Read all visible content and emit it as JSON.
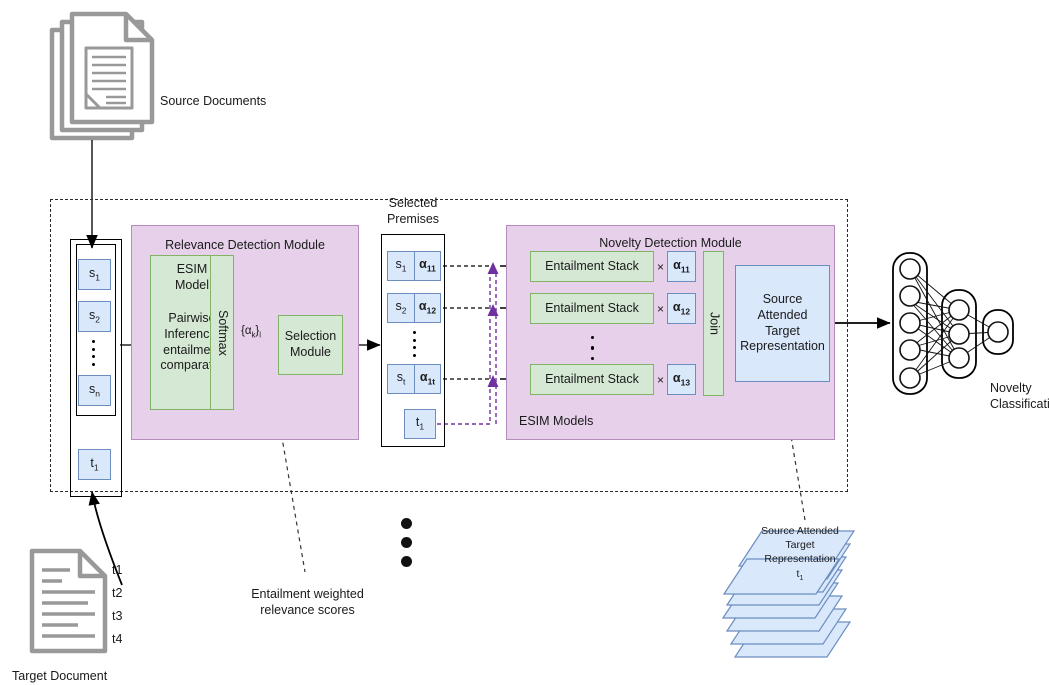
{
  "figure": {
    "source_documents_label": "Source Documents",
    "target_document_label": "Target Document",
    "target_sentences": [
      "t1",
      "t2",
      "t3",
      "t4"
    ],
    "novelty_classification_label": "Novelty Classification",
    "entailment_caption_line1": "Entailment weighted",
    "entailment_caption_line2": "relevance scores"
  },
  "input_stack": {
    "source_items": [
      "s1",
      "s2",
      "sn"
    ],
    "target_item": "t1"
  },
  "relevance_module": {
    "title": "Relevance Detection Module",
    "esim_title_line1": "ESIM",
    "esim_title_line2": "Model",
    "esim_body_line1": "Pairwise",
    "esim_body_line2": "Inference/",
    "esim_body_line3": "entailment",
    "esim_body_line4": "comparator",
    "softmax_label": "Softmax",
    "alpha_flow_label": "{αk}l",
    "selection_line1": "Selection",
    "selection_line2": "Module"
  },
  "selected_premises": {
    "title_line1": "Selected",
    "title_line2": "Premises",
    "rows": [
      {
        "sentence": "s1",
        "alpha": "α11"
      },
      {
        "sentence": "s2",
        "alpha": "α12"
      },
      {
        "sentence": "st",
        "alpha": "α1t"
      }
    ],
    "target_item": "t1"
  },
  "novelty_module": {
    "title": "Novelty Detection Module",
    "esim_models_label": "ESIM  Models",
    "stacks": [
      {
        "label": "Entailment Stack",
        "times": "×",
        "alpha": "α11"
      },
      {
        "label": "Entailment Stack",
        "times": "×",
        "alpha": "α12"
      },
      {
        "label": "Entailment Stack",
        "times": "×",
        "alpha": "α13"
      }
    ],
    "join_label": "Join",
    "satr_line1": "Source",
    "satr_line2": "Attended",
    "satr_line3": "Target",
    "satr_line4": "Representation"
  },
  "classifier": {
    "input_nodes": 5,
    "hidden_nodes": 3,
    "output_nodes": 1
  },
  "satr_stack": {
    "line1": "Source Attended",
    "line2": "Target",
    "line3": "Representation",
    "line4": "t1",
    "sheets": 8
  },
  "colors": {
    "module_fill": "#e6d0ea",
    "module_stroke": "#b58cbd",
    "green_fill": "#d5e8d4",
    "green_stroke": "#82b366",
    "blue_fill": "#dae8fc",
    "blue_stroke": "#6c8ebf",
    "purple_arrow": "#7030a0",
    "doc_gray": "#999999",
    "line_black": "#000000"
  }
}
